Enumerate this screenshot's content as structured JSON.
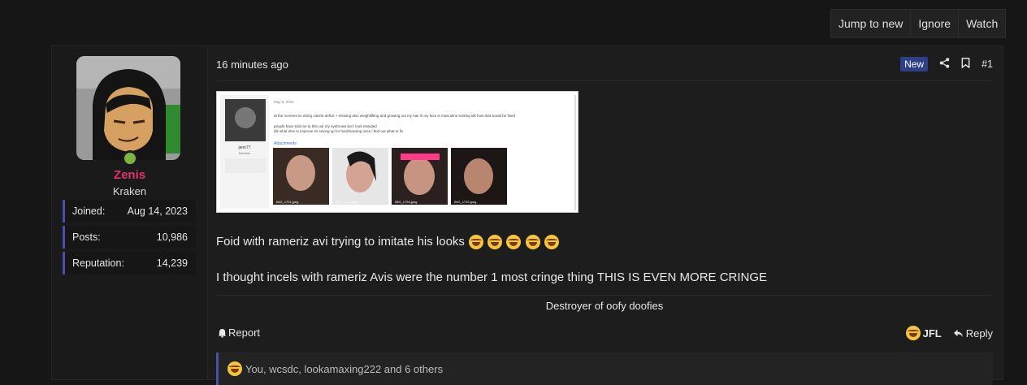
{
  "thread_buttons": {
    "jump": "Jump to new",
    "ignore": "Ignore",
    "watch": "Watch"
  },
  "user": {
    "name": "Zenis",
    "title": "Kraken",
    "stats": [
      {
        "label": "Joined:",
        "value": "Aug 14, 2023"
      },
      {
        "label": "Posts:",
        "value": "10,986"
      },
      {
        "label": "Reputation:",
        "value": "14,239"
      }
    ]
  },
  "post": {
    "time": "16 minutes ago",
    "badge": "New",
    "number": "#1",
    "line1": "Foid with rameriz avi trying to imitate his looks",
    "line2": "I thought incels with rameriz Avis were the number 1 most cringe thing THIS IS EVEN MORE CRINGE",
    "signature": "Destroyer of oofy doofies",
    "attachment": {
      "date": "May 8, 2024",
      "user": "jann77",
      "role": "Member",
      "text": [
        "at the moment im doing calorie deficit + mewing also weightlifting and growing out my hair ik my face is masculine looking idk how that would be fixed",
        "people have told me to thin out my eyebrows but i look retarded",
        "idk what else to improve im saving up for hardmaxxing once i find out what to fix"
      ],
      "attach_label": "Attachments",
      "files": [
        "IMG_1791.jpeg",
        "IMG_1793.jpeg",
        "IMG_1794.jpeg",
        "IMG_1792.jpeg"
      ]
    }
  },
  "actions": {
    "report": "Report",
    "jfl": "JFL",
    "reply": "Reply"
  },
  "reactions": {
    "text": "You, wcsdc, lookamaxing222 and 6 others"
  }
}
